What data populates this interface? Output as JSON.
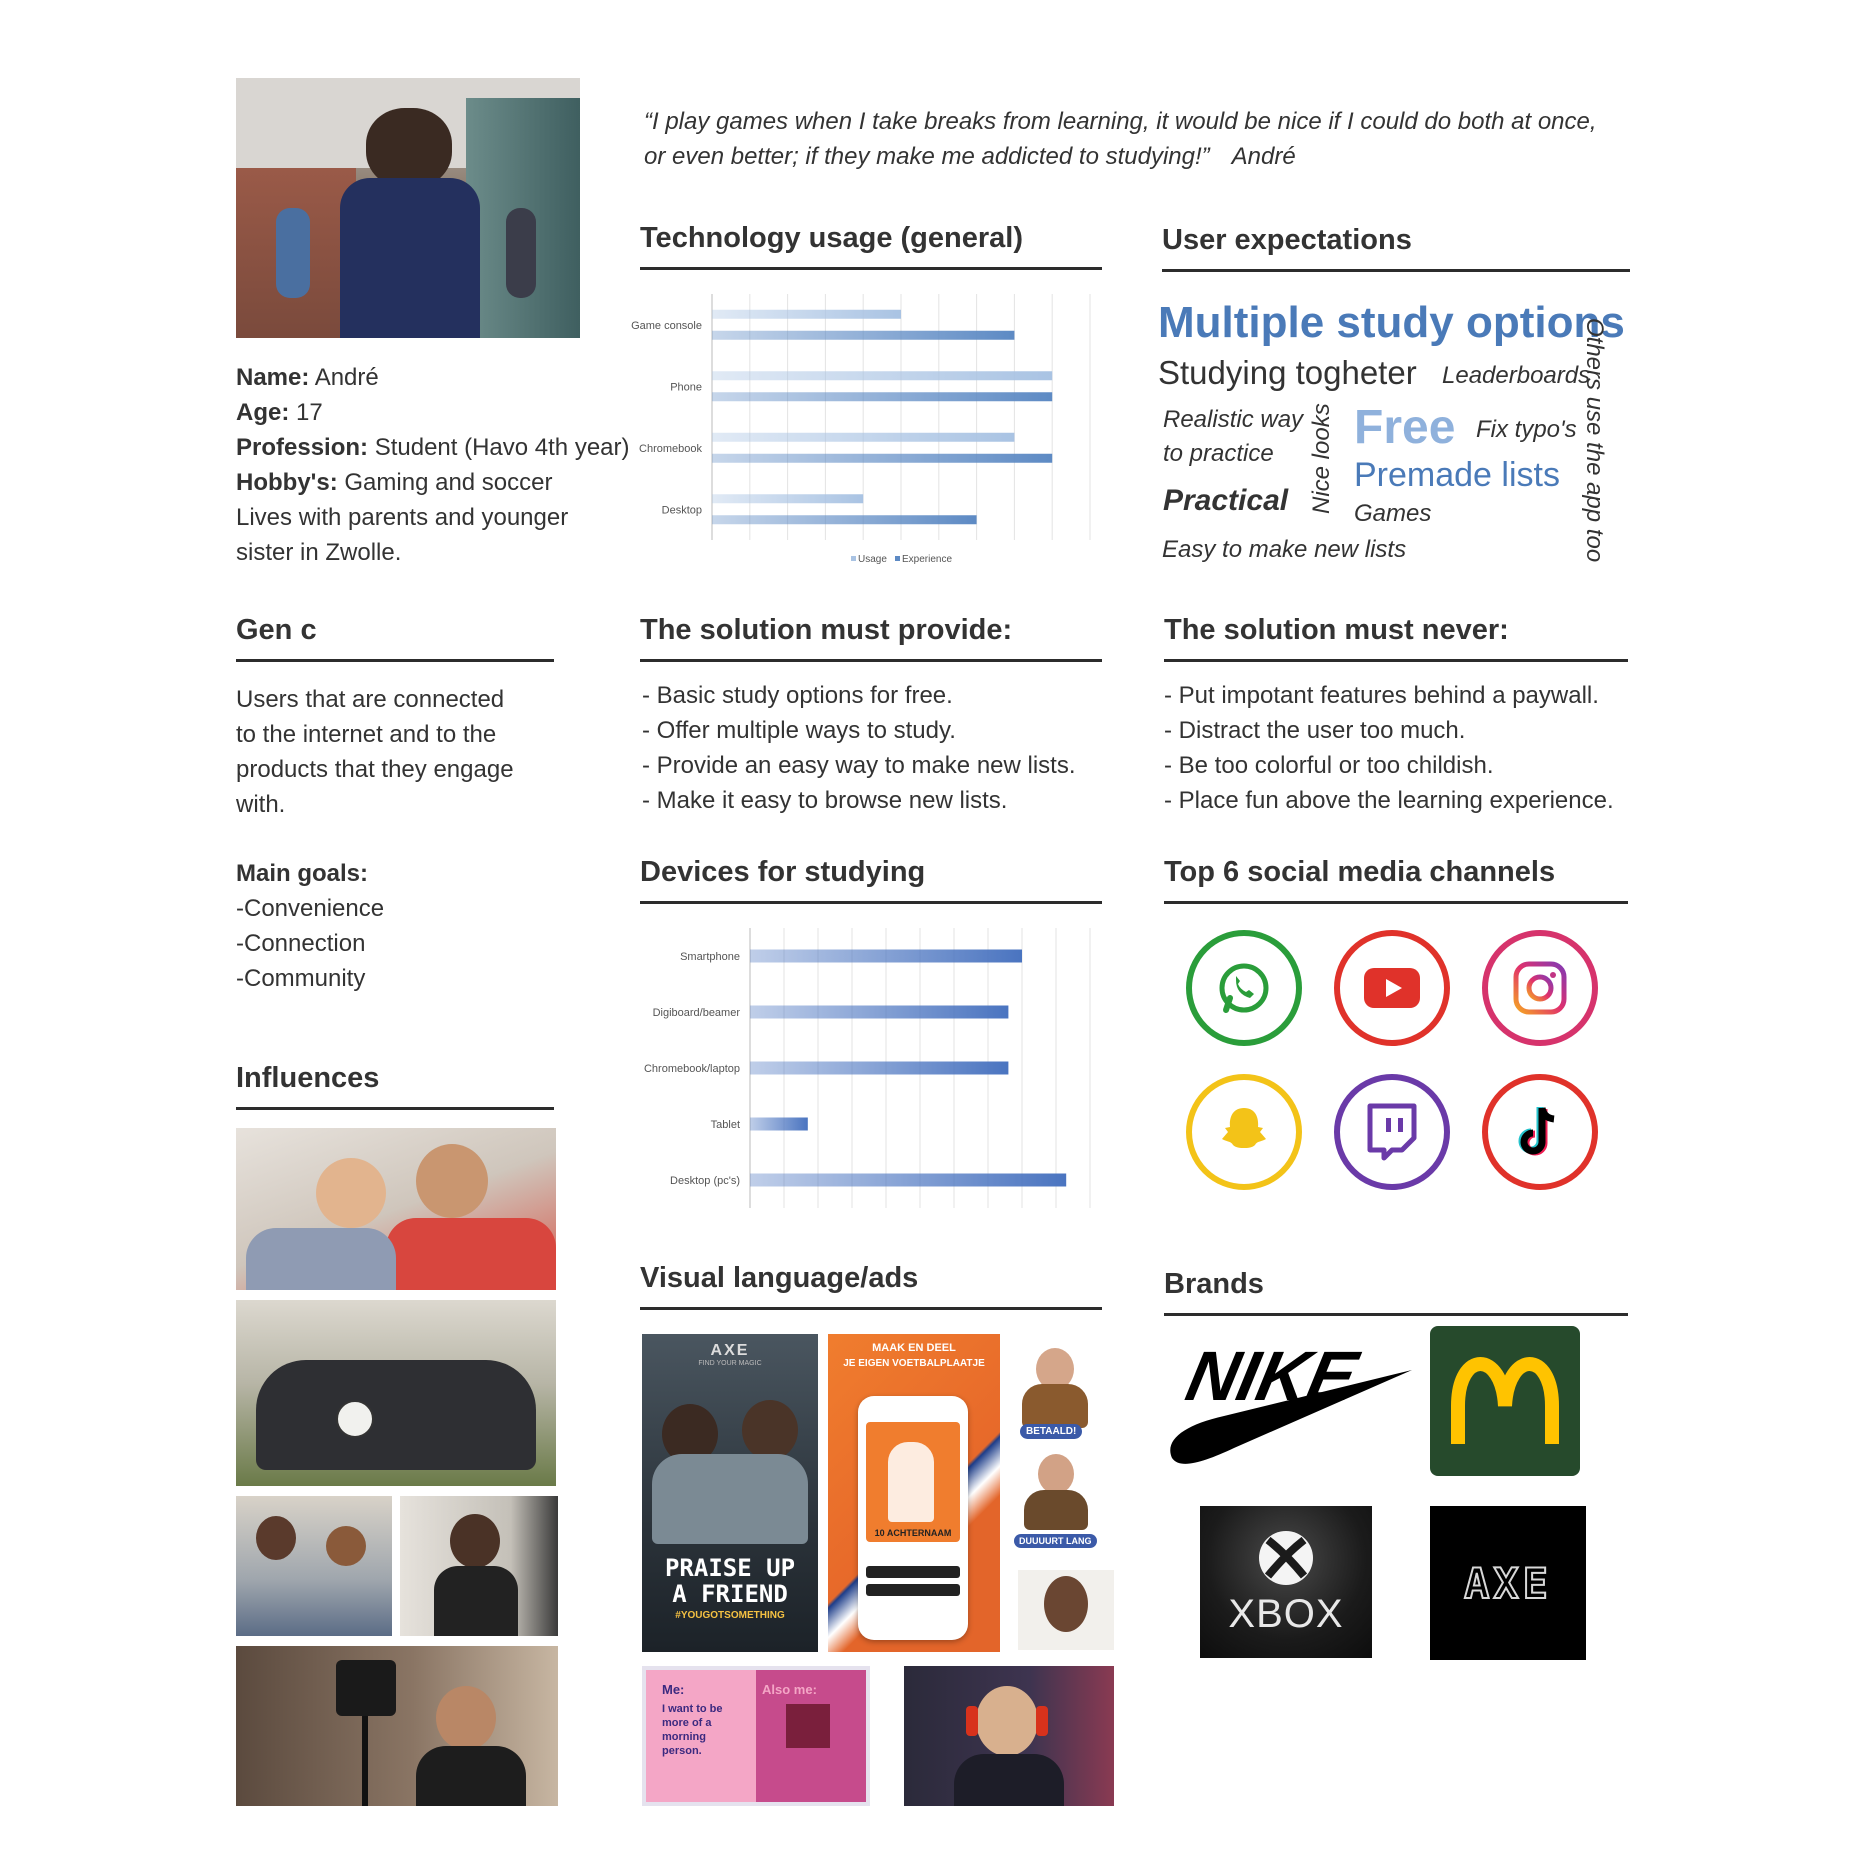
{
  "persona": {
    "name_label": "Name:",
    "name": "André",
    "age_label": "Age:",
    "age": "17",
    "profession_label": "Profession:",
    "profession": "Student (Havo 4th year)",
    "hobbies_label": "Hobby's:",
    "hobbies": "Gaming and soccer",
    "lives_line1": "Lives with parents and younger",
    "lives_line2": "sister in Zwolle."
  },
  "quote": {
    "line1": "“I play games when I take breaks from learning, it would be nice if I could do both at once,",
    "line2": "or even better; if they make me addicted to studying!”",
    "author": "André"
  },
  "sections": {
    "tech_usage": "Technology usage (general)",
    "user_expectations": "User expectations",
    "gen_c": "Gen c",
    "must_provide": "The solution must provide:",
    "must_never": "The solution must never:",
    "devices": "Devices for studying",
    "social": "Top 6 social media channels",
    "influences": "Influences",
    "visual": "Visual language/ads",
    "brands": "Brands"
  },
  "gen_c": {
    "desc": [
      "Users that are connected",
      "to the internet and to the",
      "products that they engage",
      "with."
    ],
    "goals_title": "Main goals:",
    "goals": [
      "-Convenience",
      "-Connection",
      "-Community"
    ]
  },
  "must_provide": [
    "- Basic study options for free.",
    "- Offer multiple ways to study.",
    "- Provide an easy way to make new lists.",
    "- Make it easy to browse new lists."
  ],
  "must_never": [
    "- Put impotant features behind a paywall.",
    "- Distract the user too much.",
    "- Be too colorful or too childish.",
    "- Place fun above the learning experience."
  ],
  "word_cloud": {
    "w1": "Multiple study options",
    "w2": "Studying togheter",
    "w3": "Leaderboards",
    "w4a": "Realistic way",
    "w4b": "to practice",
    "w5": "Nice looks",
    "w6": "Free",
    "w7": "Fix typo's",
    "w8": "Premade lists",
    "w9": "Practical",
    "w10": "Games",
    "w11": "Easy to make new lists",
    "w12": "Others use the app too"
  },
  "chart_data": [
    {
      "type": "bar",
      "orientation": "horizontal",
      "categories": [
        "Game console",
        "Phone",
        "Chromebook",
        "Desktop"
      ],
      "series": [
        {
          "name": "Usage",
          "values": [
            50,
            90,
            80,
            40
          ],
          "color": "#a9c3e3"
        },
        {
          "name": "Experience",
          "values": [
            80,
            90,
            90,
            70
          ],
          "color": "#5d8ac4"
        }
      ],
      "xlim": [
        0,
        100
      ],
      "grid": true,
      "legend": "bottom"
    },
    {
      "type": "bar",
      "orientation": "horizontal",
      "categories": [
        "Smartphone",
        "Digiboard/beamer",
        "Chromebook/laptop",
        "Tablet",
        "Desktop (pc's)"
      ],
      "series": [
        {
          "values": [
            80,
            76,
            76,
            17,
            93
          ],
          "color": "#4a74c0"
        }
      ],
      "xlim": [
        0,
        100
      ],
      "grid": true
    }
  ],
  "social_icons": [
    "whatsapp-icon",
    "youtube-icon",
    "instagram-icon",
    "snapchat-icon",
    "twitch-icon",
    "tiktok-icon"
  ],
  "brands": {
    "nike": "NIKE",
    "xbox": "XBOX",
    "axe": "AXE"
  },
  "ads": {
    "axe_logo": "AXE",
    "axe_tag": "FIND YOUR MAGIC",
    "axe_line1": "PRAISE UP",
    "axe_line2": "A FRIEND",
    "axe_hashtag": "#YOUGOTSOMETHING",
    "knvb_line1": "MAAK EN DEEL",
    "knvb_line2": "JE EIGEN VOETBALPLAATJE",
    "knvb_card": "10 ACHTERNAAM",
    "sticker1": "BETAALD!",
    "sticker2": "DUUUURT LANG",
    "spotify_me": "Me:",
    "spotify_me_text": "I want to be more of a morning person.",
    "spotify_also": "Also me:"
  },
  "colors": {
    "accent_blue": "#4a7ab8",
    "word_light": "#8fb1dc",
    "whatsapp": "#2a9d3a",
    "youtube": "#e0322a",
    "snapchat": "#f3c318",
    "twitch": "#6a3aa8",
    "mcdonalds_green": "#264a2c",
    "mcdonalds_yellow": "#ffc300"
  }
}
